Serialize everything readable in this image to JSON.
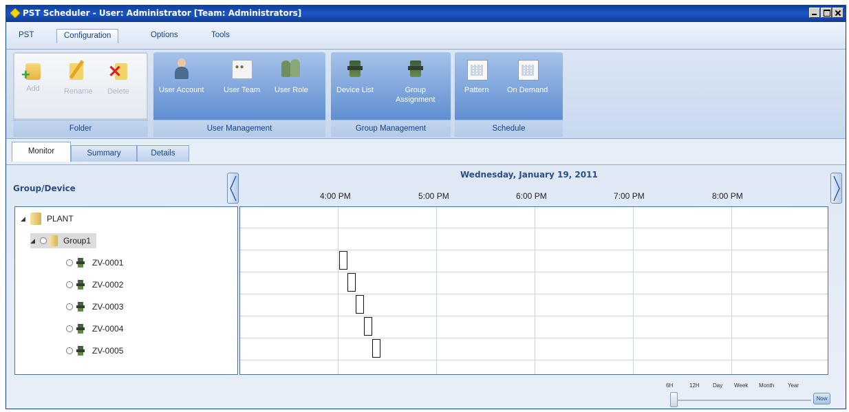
{
  "window": {
    "title": "PST Scheduler - User: Administrator [Team: Administrators]"
  },
  "menu": {
    "tabs": [
      {
        "label": "PST"
      },
      {
        "label": "Configuration"
      },
      {
        "label": "Options"
      },
      {
        "label": "Tools"
      }
    ],
    "active": "Configuration"
  },
  "ribbon": {
    "folder": {
      "label": "Folder",
      "buttons": [
        {
          "label": "Add",
          "icon": "folder-add-icon",
          "enabled": false
        },
        {
          "label": "Rename",
          "icon": "rename-icon",
          "enabled": false
        },
        {
          "label": "Delete",
          "icon": "delete-icon",
          "enabled": false
        }
      ]
    },
    "user_management": {
      "label": "User Management",
      "buttons": [
        {
          "label": "User Account",
          "icon": "user-account-icon"
        },
        {
          "label": "User Team",
          "icon": "user-team-icon"
        },
        {
          "label": "User Role",
          "icon": "user-role-icon"
        }
      ]
    },
    "group_management": {
      "label": "Group Management",
      "buttons": [
        {
          "label": "Device List",
          "icon": "device-list-icon"
        },
        {
          "label_line1": "Group",
          "label_line2": "Assignment",
          "icon": "group-assignment-icon"
        }
      ]
    },
    "schedule": {
      "label": "Schedule",
      "buttons": [
        {
          "label": "Pattern",
          "icon": "pattern-icon"
        },
        {
          "label": "On Demand",
          "icon": "on-demand-icon"
        }
      ]
    }
  },
  "view_tabs": [
    {
      "label": "Monitor",
      "active": true
    },
    {
      "label": "Summary",
      "active": false
    },
    {
      "label": "Details",
      "active": false
    }
  ],
  "monitor": {
    "group_device_header": "Group/Device",
    "date": "Wednesday, January 19, 2011",
    "hours": [
      "4:00 PM",
      "5:00 PM",
      "6:00 PM",
      "7:00 PM",
      "8:00 PM"
    ],
    "tree": {
      "root": "PLANT",
      "group": "Group1",
      "devices": [
        "ZV-0001",
        "ZV-0002",
        "ZV-0003",
        "ZV-0004",
        "ZV-0005"
      ]
    },
    "zoom_levels": [
      "6H",
      "12H",
      "Day",
      "Week",
      "Month",
      "Year"
    ],
    "zoom_selected": "6H",
    "now_button": "Now"
  },
  "colors": {
    "titlebar": "#1b56c6",
    "ribbon_blue": "#5f8fd2",
    "header_text": "#2a4e86"
  }
}
